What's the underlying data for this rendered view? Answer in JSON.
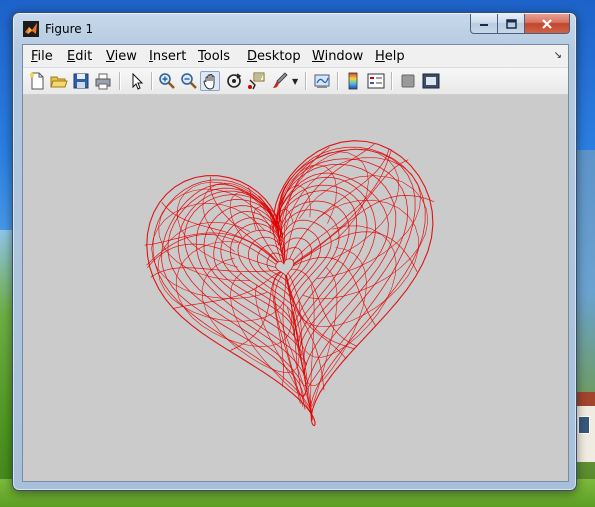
{
  "window": {
    "title": "Figure 1",
    "caption_buttons": [
      "minimize",
      "maximize",
      "close"
    ]
  },
  "menubar": {
    "items": [
      {
        "label": "File",
        "mnemonic": "F",
        "rest": "ile"
      },
      {
        "label": "Edit",
        "mnemonic": "E",
        "rest": "dit"
      },
      {
        "label": "View",
        "mnemonic": "V",
        "rest": "iew"
      },
      {
        "label": "Insert",
        "mnemonic": "I",
        "rest": "nsert"
      },
      {
        "label": "Tools",
        "mnemonic": "T",
        "rest": "ools"
      },
      {
        "label": "Desktop",
        "mnemonic": "D",
        "rest": "esktop"
      },
      {
        "label": "Window",
        "mnemonic": "W",
        "rest": "indow"
      },
      {
        "label": "Help",
        "mnemonic": "H",
        "rest": "elp"
      }
    ],
    "dock_icon": "dock-arrow-icon"
  },
  "toolbar": {
    "buttons": [
      "new-figure-icon",
      "open-file-icon",
      "save-icon",
      "print-icon",
      "edit-plot-icon",
      "zoom-in-icon",
      "zoom-out-icon",
      "pan-icon",
      "rotate-3d-icon",
      "data-cursor-icon",
      "brush-icon",
      "link-plot-icon",
      "colorbar-icon",
      "legend-icon",
      "hide-plot-tools-icon",
      "show-plot-tools-icon"
    ],
    "active": "pan-icon"
  },
  "figure": {
    "background": "#cbcbcb",
    "mesh_color": "#e00000",
    "content": "red wireframe heart-shaped 3D surface"
  },
  "colors": {
    "window_frame": "#b3c9e0",
    "close_button": "#c2452c",
    "canvas": "#cbcbcb"
  }
}
